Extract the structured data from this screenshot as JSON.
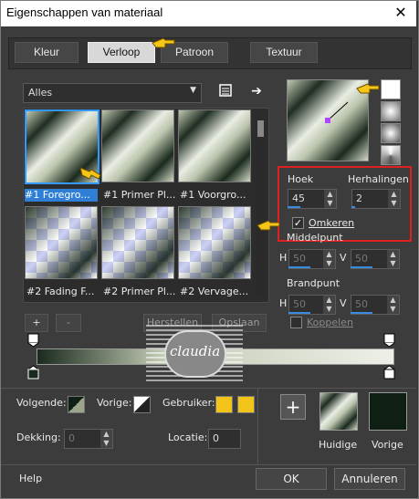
{
  "window": {
    "title": "Eigenschappen van materiaal",
    "close_glyph": "✕"
  },
  "tabs": [
    {
      "label": "Kleur",
      "active": false
    },
    {
      "label": "Verloop",
      "active": true
    },
    {
      "label": "Patroon",
      "active": false
    },
    {
      "label": "Textuur",
      "active": false
    }
  ],
  "category_dropdown": {
    "value": "Alles"
  },
  "gallery": {
    "items": [
      {
        "label": "#1 Foregro...",
        "style": "gradient",
        "selected": true
      },
      {
        "label": "#1 Primer Pl...",
        "style": "gradient",
        "selected": false
      },
      {
        "label": "#1 Voorgro...",
        "style": "gradient",
        "selected": false
      },
      {
        "label": "#2 Fading F...",
        "style": "fading",
        "selected": false
      },
      {
        "label": "#2 Primer Pl...",
        "style": "fading",
        "selected": false
      },
      {
        "label": "#2 Vervage...",
        "style": "fading",
        "selected": false
      }
    ]
  },
  "gallery_buttons": {
    "add": "+",
    "remove": "-",
    "restore": "Herstellen",
    "save": "Opslaan"
  },
  "watermark": {
    "text": "claudia"
  },
  "gradient": {
    "angle_label": "Hoek",
    "angle": "45",
    "repeats_label": "Herhalingen",
    "repeats": "2",
    "invert_label": "Omkeren",
    "invert_checked": true,
    "center_label": "Middelpunt",
    "center_h_label": "H",
    "center_h": "50",
    "center_v_label": "V",
    "center_v": "50",
    "focal_label": "Brandpunt",
    "focal_h_label": "H",
    "focal_h": "50",
    "focal_v_label": "V",
    "focal_v": "50",
    "link_label": "Koppelen",
    "link_checked": false
  },
  "bottom": {
    "foreground_label": "Volgende:",
    "background_label": "Vorige:",
    "user_label": "Gebruiker:",
    "user_colors": [
      "#f2c318",
      "#f2c318"
    ],
    "opacity_label": "Dekking:",
    "opacity": "0",
    "location_label": "Locatie:",
    "location": "0",
    "current_label": "Huidige",
    "previous_label": "Vorige",
    "previous_color": "#0f1f14"
  },
  "footer": {
    "help": "Help",
    "ok": "OK",
    "cancel": "Annuleren"
  },
  "colors": {
    "accent": "#3399ff",
    "highlight_box": "#e02020",
    "dark_green": "#1a2a1d"
  }
}
